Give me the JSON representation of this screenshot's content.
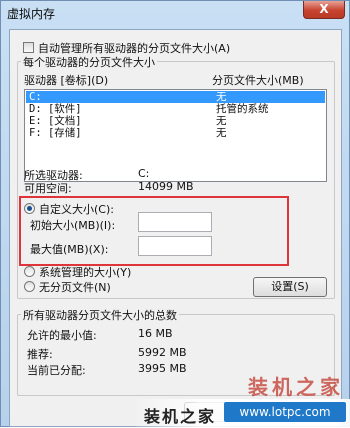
{
  "window": {
    "title": "虚拟内存",
    "close_glyph": "X"
  },
  "auto_manage": {
    "label": "自动管理所有驱动器的分页文件大小(A)",
    "checked": false
  },
  "per_drive_group": {
    "title": "每个驱动器的分页文件大小",
    "header_drive": "驱动器 [卷标](D)",
    "header_size": "分页文件大小(MB)",
    "drives": [
      {
        "drive": "C:",
        "size": "无",
        "selected": true
      },
      {
        "drive": "D:   [软件]",
        "size": "托管的系统",
        "selected": false
      },
      {
        "drive": "E:   [文档]",
        "size": "无",
        "selected": false
      },
      {
        "drive": "F:   [存储]",
        "size": "无",
        "selected": false
      }
    ],
    "selected_drive_label": "所选驱动器:",
    "selected_drive_value": "C:",
    "free_space_label": "可用空间:",
    "free_space_value": "14099 MB",
    "custom_size_label": "自定义大小(C):",
    "initial_size_label": "初始大小(MB)(I):",
    "initial_size_value": "",
    "max_size_label": "最大值(MB)(X):",
    "max_size_value": "",
    "system_managed_label": "系统管理的大小(Y)",
    "no_paging_label": "无分页文件(N)",
    "selected_option": "custom",
    "set_button": "设置(S)"
  },
  "total_group": {
    "title": "所有驱动器分页文件大小的总数",
    "min_allowed_label": "允许的最小值:",
    "min_allowed_value": "16 MB",
    "recommended_label": "推荐:",
    "recommended_value": "5992 MB",
    "current_label": "当前已分配:",
    "current_value": "3995 MB"
  },
  "watermark": {
    "brand": "装机之家",
    "url": "www.lotpc.com",
    "brand_large": "装机之家"
  },
  "colors": {
    "highlight": "#e0343b",
    "selection": "#3399ff",
    "close_button": "#c7442f"
  }
}
